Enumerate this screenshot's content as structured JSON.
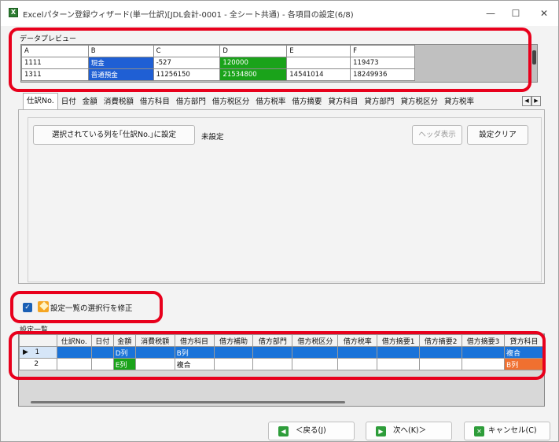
{
  "window": {
    "title": "Excelパターン登録ウィザード(単一仕訳)[JDL会計-0001 - 全シート共通) - 各項目の設定(6/8)",
    "minimize": "—",
    "maximize": "☐",
    "close": "✕"
  },
  "preview": {
    "label": "データプレビュー",
    "headers": [
      "A",
      "B",
      "C",
      "D",
      "E",
      "F"
    ],
    "rows": [
      [
        "1111",
        "現金",
        "-527",
        "120000",
        "",
        "119473"
      ],
      [
        "1311",
        "普通預金",
        "11256150",
        "21534800",
        "14541014",
        "18249936"
      ]
    ]
  },
  "tabs": [
    "仕訳No.",
    "日付",
    "金額",
    "消費税額",
    "借方科目",
    "借方部門",
    "借方税区分",
    "借方税率",
    "借方摘要",
    "貸方科目",
    "貸方部門",
    "貸方税区分",
    "貸方税率"
  ],
  "panel": {
    "set_column_button": "選択されている列を｢仕訳No.｣に設定",
    "status": "未設定",
    "header_display_button": "ヘッダ表示",
    "clear_button": "設定クリア"
  },
  "modify_checkbox": {
    "checked": true,
    "label": "設定一覧の選択行を修正"
  },
  "settings": {
    "label": "設定一覧",
    "headers": [
      "",
      "仕訳No.",
      "日付",
      "金額",
      "消費税額",
      "借方科目",
      "借方補助",
      "借方部門",
      "借方税区分",
      "借方税率",
      "借方摘要1",
      "借方摘要2",
      "借方摘要3",
      "貸方科目"
    ],
    "rows": [
      {
        "marker": "▶",
        "num": "1",
        "cells": [
          "",
          "",
          "D列",
          "",
          "B列",
          "",
          "",
          "",
          "",
          "",
          "",
          "",
          "複合"
        ]
      },
      {
        "marker": "",
        "num": "2",
        "cells": [
          "",
          "",
          "E列",
          "",
          "複合",
          "",
          "",
          "",
          "",
          "",
          "",
          "",
          "B列"
        ]
      }
    ]
  },
  "footer": {
    "back": "＜戻る(J)",
    "next": "次へ(K)＞",
    "cancel": "キャンセル(C)"
  },
  "colors": {
    "selection_blue": "#1a73d9",
    "cash_blue": "#1f5fd4",
    "green": "#1aa31a",
    "orange": "#f07030",
    "red_frame": "#e8001c"
  }
}
